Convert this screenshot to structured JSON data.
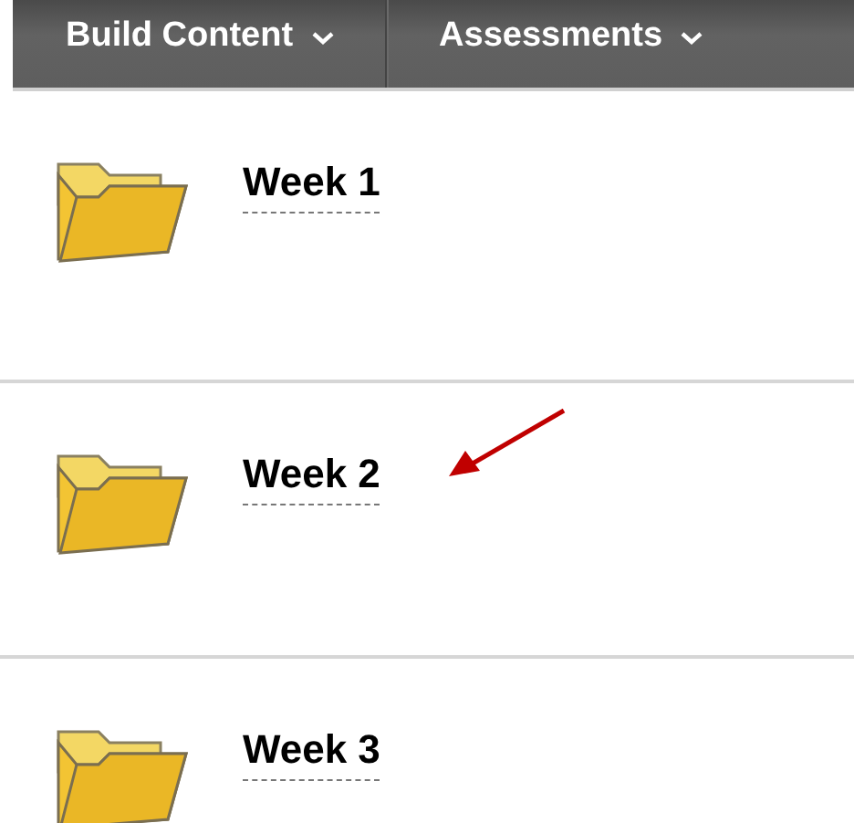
{
  "toolbar": {
    "menus": [
      {
        "label": "Build Content"
      },
      {
        "label": "Assessments"
      }
    ]
  },
  "items": [
    {
      "title": "Week 1",
      "annotated": false
    },
    {
      "title": "Week 2",
      "annotated": true
    },
    {
      "title": "Week 3",
      "annotated": false
    }
  ]
}
